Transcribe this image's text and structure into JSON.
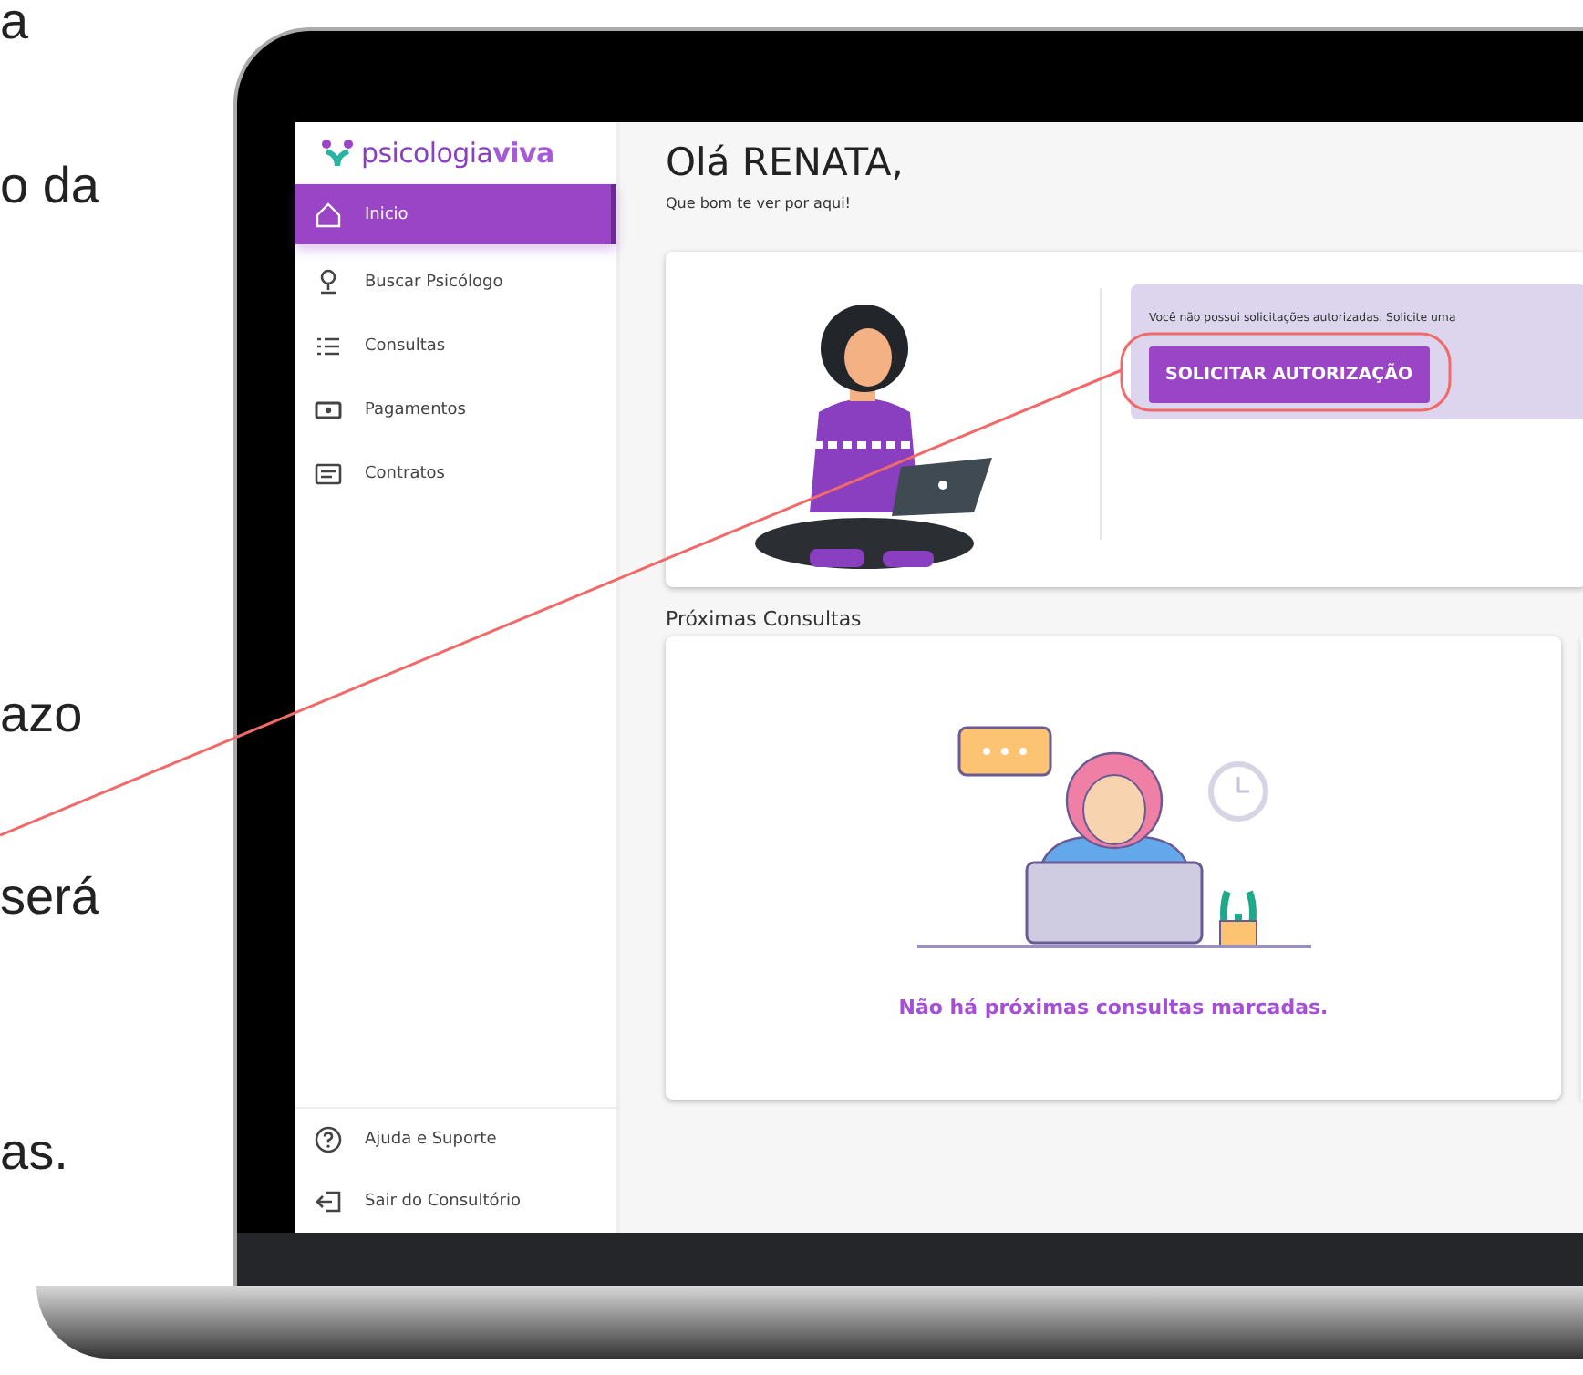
{
  "slide_text": [
    "a",
    "o da",
    "azo",
    "será",
    "as."
  ],
  "app": {
    "logo": {
      "part_1": "psicologia",
      "part_2": "viva"
    },
    "nav": [
      {
        "label": "Inicio",
        "selected": true
      },
      {
        "label": "Buscar Psicólogo",
        "selected": false
      },
      {
        "label": "Consultas",
        "selected": false
      },
      {
        "label": "Pagamentos",
        "selected": false
      },
      {
        "label": "Contratos",
        "selected": false
      }
    ],
    "footer_nav": [
      {
        "label": "Ajuda e Suporte"
      },
      {
        "label": "Sair do Consultório"
      }
    ],
    "greeting": "Olá RENATA,",
    "subtitle": "Que bom te ver por aqui!",
    "notice": {
      "text": "Você não possui solicitações autorizadas. Solicite uma",
      "button": "SOLICITAR AUTORIZAÇÃO"
    },
    "section_title": "Próximas Consultas",
    "empty_message": "Não há próximas consultas marcadas."
  }
}
